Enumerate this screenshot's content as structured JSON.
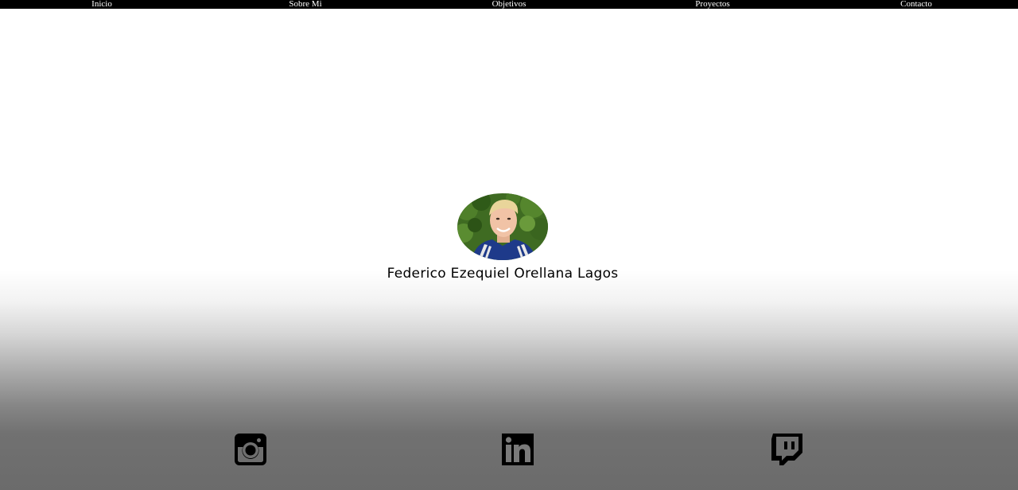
{
  "nav": {
    "items": [
      {
        "label": "Inicio"
      },
      {
        "label": "Sobre Mi"
      },
      {
        "label": "Objetivos"
      },
      {
        "label": "Proyectos"
      },
      {
        "label": "Contacto"
      }
    ]
  },
  "profile": {
    "name": "Federico Ezequiel Orellana Lagos",
    "avatar_icon": "profile-photo"
  },
  "socials": [
    {
      "icon": "instagram-icon"
    },
    {
      "icon": "linkedin-icon"
    },
    {
      "icon": "twitch-icon"
    }
  ],
  "colors": {
    "nav_bg": "#000000",
    "nav_text": "#ffffff",
    "icon": "#000000",
    "bg_top": "#ffffff",
    "bg_bottom": "#6b6b6b"
  }
}
